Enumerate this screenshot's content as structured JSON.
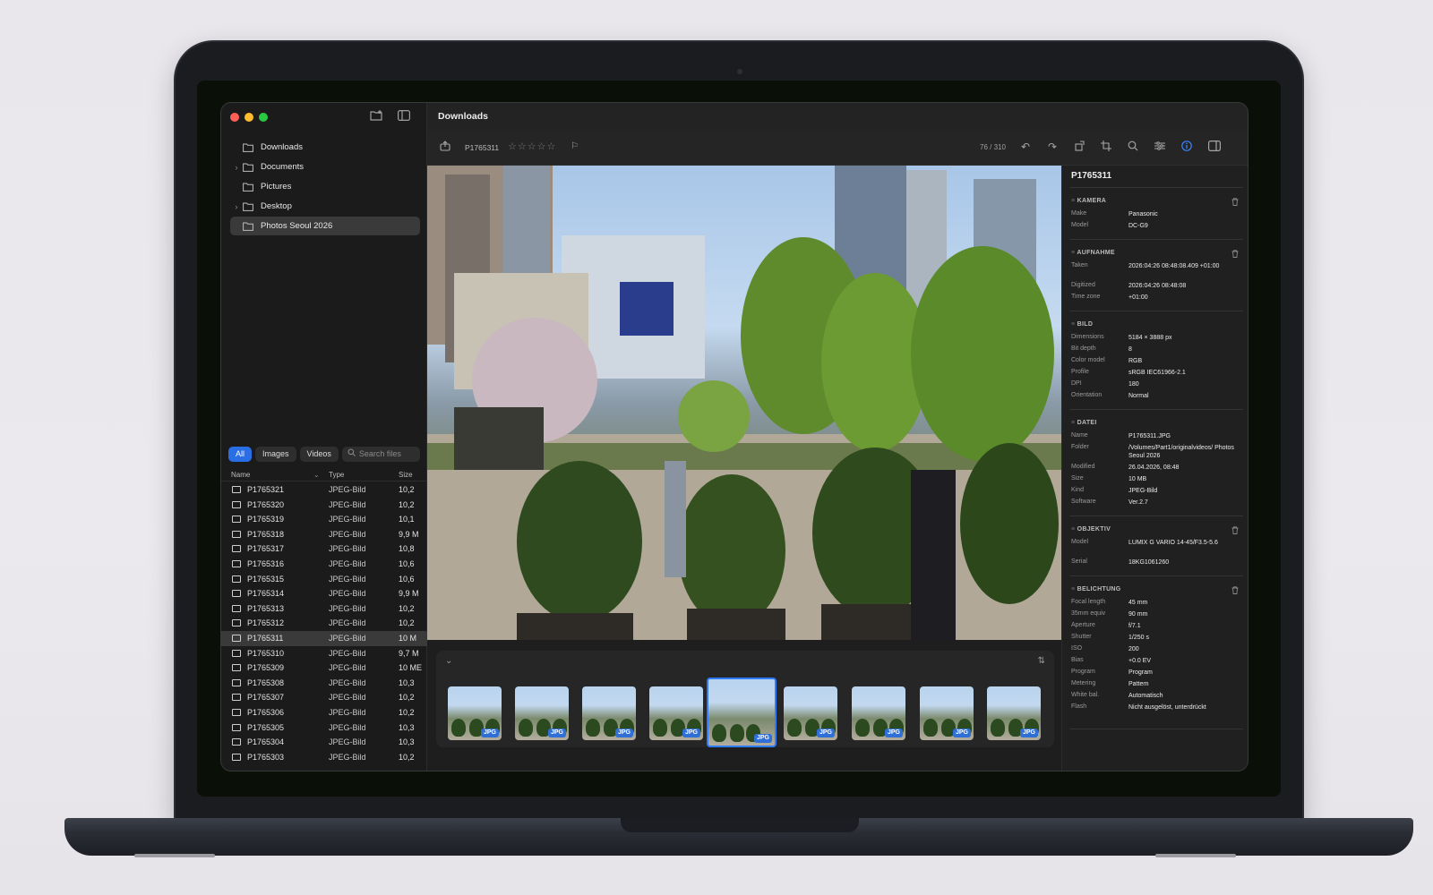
{
  "window": {
    "title": "Downloads"
  },
  "sidebar": {
    "items": [
      {
        "label": "Downloads",
        "expandable": false
      },
      {
        "label": "Documents",
        "expandable": true
      },
      {
        "label": "Pictures",
        "expandable": false
      },
      {
        "label": "Desktop",
        "expandable": true
      },
      {
        "label": "Photos Seoul 2026",
        "expandable": false,
        "selected": true
      }
    ],
    "filters": [
      "All",
      "Images",
      "Videos"
    ],
    "search_placeholder": "Search files",
    "columns": {
      "name": "Name",
      "type": "Type",
      "size": "Size"
    },
    "files": [
      {
        "name": "P1765321",
        "type": "JPEG-Bild",
        "size": "10,2"
      },
      {
        "name": "P1765320",
        "type": "JPEG-Bild",
        "size": "10,2"
      },
      {
        "name": "P1765319",
        "type": "JPEG-Bild",
        "size": "10,1"
      },
      {
        "name": "P1765318",
        "type": "JPEG-Bild",
        "size": "9,9 M"
      },
      {
        "name": "P1765317",
        "type": "JPEG-Bild",
        "size": "10,8"
      },
      {
        "name": "P1765316",
        "type": "JPEG-Bild",
        "size": "10,6"
      },
      {
        "name": "P1765315",
        "type": "JPEG-Bild",
        "size": "10,6"
      },
      {
        "name": "P1765314",
        "type": "JPEG-Bild",
        "size": "9,9 M"
      },
      {
        "name": "P1765313",
        "type": "JPEG-Bild",
        "size": "10,2"
      },
      {
        "name": "P1765312",
        "type": "JPEG-Bild",
        "size": "10,2"
      },
      {
        "name": "P1765311",
        "type": "JPEG-Bild",
        "size": "10 M",
        "selected": true
      },
      {
        "name": "P1765310",
        "type": "JPEG-Bild",
        "size": "9,7 M"
      },
      {
        "name": "P1765309",
        "type": "JPEG-Bild",
        "size": "10 ME"
      },
      {
        "name": "P1765308",
        "type": "JPEG-Bild",
        "size": "10,3"
      },
      {
        "name": "P1765307",
        "type": "JPEG-Bild",
        "size": "10,2"
      },
      {
        "name": "P1765306",
        "type": "JPEG-Bild",
        "size": "10,2"
      },
      {
        "name": "P1765305",
        "type": "JPEG-Bild",
        "size": "10,3"
      },
      {
        "name": "P1765304",
        "type": "JPEG-Bild",
        "size": "10,3"
      },
      {
        "name": "P1765303",
        "type": "JPEG-Bild",
        "size": "10,2"
      }
    ]
  },
  "toolbar": {
    "filename": "P1765311",
    "rating": 0,
    "counter": "76 / 310"
  },
  "filmstrip": {
    "badge": "JPG",
    "count": 9,
    "selected_index": 4
  },
  "inspector": {
    "title": "P1765311",
    "sections": [
      {
        "name": "KAMERA",
        "deletable": true,
        "rows": [
          {
            "k": "Make",
            "v": "Panasonic"
          },
          {
            "k": "Model",
            "v": "DC-G9"
          }
        ]
      },
      {
        "name": "AUFNAHME",
        "deletable": true,
        "rows": [
          {
            "k": "Taken",
            "v": "2026:04:26 08:48:08.409 +01:00"
          },
          {
            "k": "Digitized",
            "v": "2026:04:26 08:48:08"
          },
          {
            "k": "Time zone",
            "v": "+01:00"
          }
        ]
      },
      {
        "name": "BILD",
        "deletable": false,
        "rows": [
          {
            "k": "Dimensions",
            "v": "5184 × 3888 px"
          },
          {
            "k": "Bit depth",
            "v": "8"
          },
          {
            "k": "Color model",
            "v": "RGB"
          },
          {
            "k": "Profile",
            "v": "sRGB IEC61966-2.1"
          },
          {
            "k": "DPI",
            "v": "180"
          },
          {
            "k": "Orientation",
            "v": "Normal"
          }
        ]
      },
      {
        "name": "DATEI",
        "deletable": false,
        "rows": [
          {
            "k": "Name",
            "v": "P1765311.JPG"
          },
          {
            "k": "Folder",
            "v": "/Volumes/Part1/originalvideos/ Photos Seoul 2026"
          },
          {
            "k": "Modified",
            "v": "26.04.2026, 08:48"
          },
          {
            "k": "Size",
            "v": "10 MB"
          },
          {
            "k": "Kind",
            "v": "JPEG-Bild"
          },
          {
            "k": "Software",
            "v": "Ver.2.7"
          }
        ]
      },
      {
        "name": "OBJEKTIV",
        "deletable": true,
        "rows": [
          {
            "k": "Model",
            "v": "LUMIX G VARIO 14-45/F3.5-5.6"
          },
          {
            "k": "Serial",
            "v": "18KG1061260"
          }
        ]
      },
      {
        "name": "BELICHTUNG",
        "deletable": true,
        "rows": [
          {
            "k": "Focal length",
            "v": "45 mm"
          },
          {
            "k": "35mm equiv",
            "v": "90 mm"
          },
          {
            "k": "Aperture",
            "v": "f/7.1"
          },
          {
            "k": "Shutter",
            "v": "1/250 s"
          },
          {
            "k": "ISO",
            "v": "200"
          },
          {
            "k": "Bias",
            "v": "+0.0 EV"
          },
          {
            "k": "Program",
            "v": "Program"
          },
          {
            "k": "Metering",
            "v": "Pattern"
          },
          {
            "k": "White bal.",
            "v": "Automatisch"
          },
          {
            "k": "Flash",
            "v": "Nicht ausgelöst, unterdrückt"
          }
        ]
      }
    ]
  },
  "colors": {
    "accent": "#2a6ee6",
    "traffic_red": "#ff5f57",
    "traffic_yellow": "#febc2e",
    "traffic_green": "#28c840"
  }
}
